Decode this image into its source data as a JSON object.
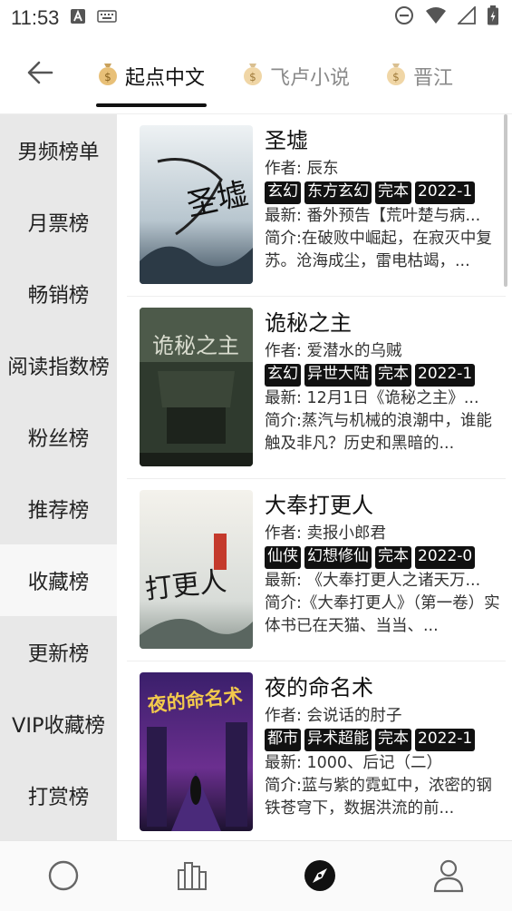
{
  "status_bar": {
    "time": "11:53"
  },
  "tabs": [
    {
      "label": "起点中文",
      "active": true
    },
    {
      "label": "飞卢小说",
      "active": false
    },
    {
      "label": "晋江",
      "active": false
    }
  ],
  "sidebar": {
    "items": [
      {
        "label": "男频榜单"
      },
      {
        "label": "月票榜"
      },
      {
        "label": "畅销榜"
      },
      {
        "label": "阅读指数榜"
      },
      {
        "label": "粉丝榜"
      },
      {
        "label": "推荐榜"
      },
      {
        "label": "收藏榜",
        "active": true
      },
      {
        "label": "更新榜"
      },
      {
        "label": "VIP收藏榜"
      },
      {
        "label": "打赏榜"
      }
    ]
  },
  "books": [
    {
      "title": "圣墟",
      "cover_text": "圣墟",
      "author": "作者: 辰东",
      "tags": [
        "玄幻",
        "东方玄幻",
        "完本",
        "2022-1"
      ],
      "latest": "最新: 番外预告【荒叶楚与病...",
      "intro": "简介:在破败中崛起，在寂灭中复苏。沧海成尘，雷电枯竭，..."
    },
    {
      "title": "诡秘之主",
      "cover_text": "诡秘之主",
      "author": "作者: 爱潜水的乌贼",
      "tags": [
        "玄幻",
        "异世大陆",
        "完本",
        "2022-1"
      ],
      "latest": "最新: 12月1日《诡秘之主》...",
      "intro": "简介:蒸汽与机械的浪潮中，谁能触及非凡？历史和黑暗的..."
    },
    {
      "title": "大奉打更人",
      "cover_text": "打更人",
      "author": "作者: 卖报小郎君",
      "tags": [
        "仙侠",
        "幻想修仙",
        "完本",
        "2022-0"
      ],
      "latest": "最新: 《大奉打更人之诸天万...",
      "intro": "简介:《大奉打更人》（第一卷）实体书已在天猫、当当、..."
    },
    {
      "title": "夜的命名术",
      "cover_text": "夜的命名术",
      "author": "作者: 会说话的肘子",
      "tags": [
        "都市",
        "异术超能",
        "完本",
        "2022-1"
      ],
      "latest": "最新: 1000、后记（二）",
      "intro": "简介:蓝与紫的霓虹中，浓密的钢铁苍穹下，数据洪流的前..."
    }
  ],
  "bottom_nav": [
    {
      "icon": "circle-icon",
      "active": false
    },
    {
      "icon": "bookshelf-icon",
      "active": false
    },
    {
      "icon": "compass-icon",
      "active": true
    },
    {
      "icon": "person-icon",
      "active": false
    }
  ],
  "colors": {
    "accent": "#111111",
    "sidebar_bg": "#e8e8e8",
    "sidebar_active_bg": "#f7f7f7",
    "tag_bg": "#111111",
    "inactive_tab": "#8a8a8a"
  }
}
